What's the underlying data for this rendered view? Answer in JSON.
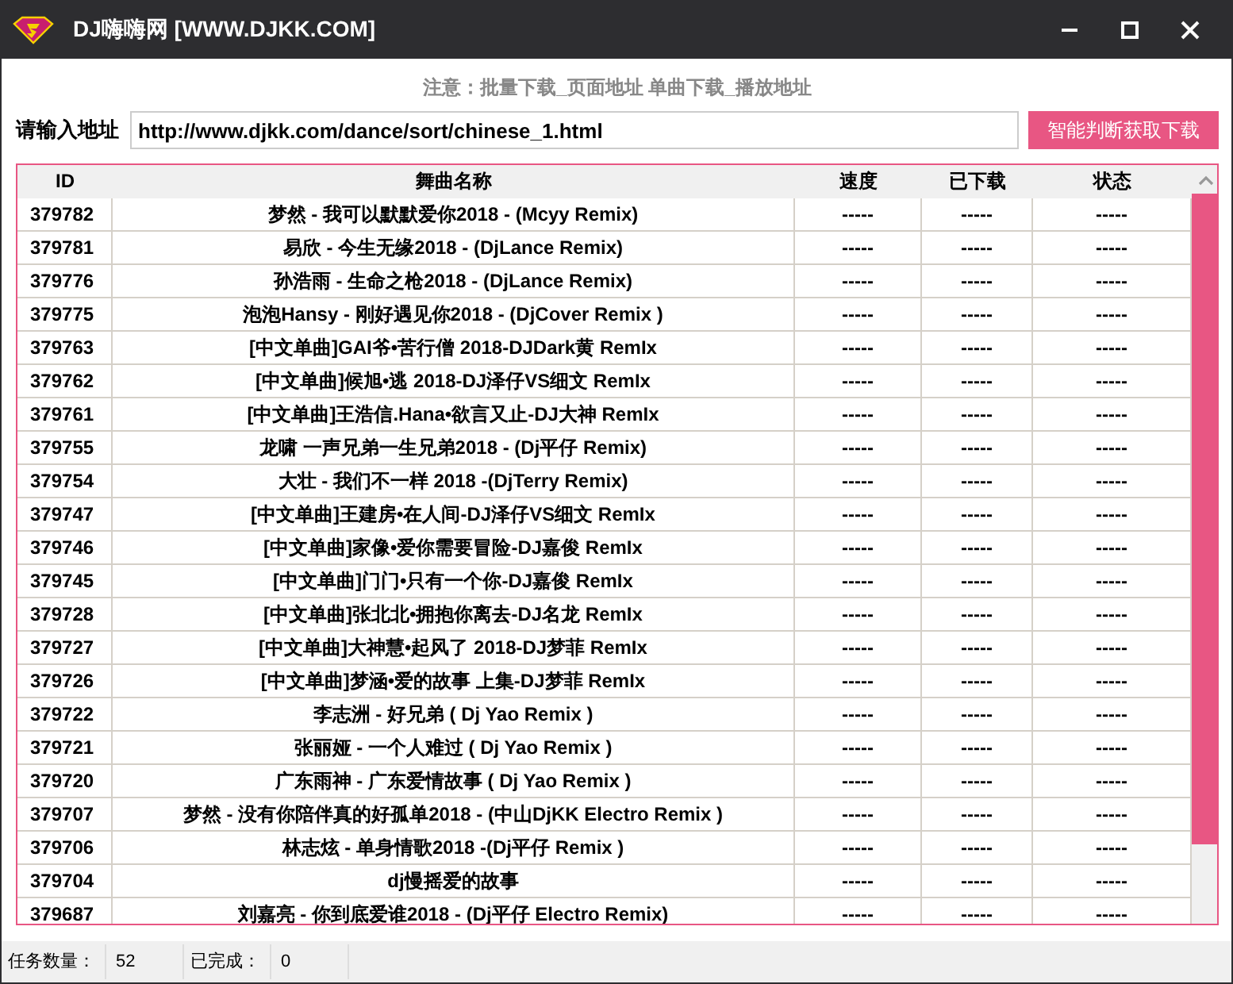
{
  "window": {
    "title": "DJ嗨嗨网 [WWW.DJKK.COM]"
  },
  "notice": "注意：批量下载_页面地址 单曲下载_播放地址",
  "address": {
    "label": "请输入地址",
    "value": "http://www.djkk.com/dance/sort/chinese_1.html"
  },
  "fetch_button": "智能判断获取下载",
  "table": {
    "columns": [
      "ID",
      "舞曲名称",
      "速度",
      "已下载",
      "状态"
    ],
    "rows": [
      [
        "379782",
        "梦然 - 我可以默默爱你2018 - (Mcyy  Remix)",
        "-----",
        "-----",
        "-----"
      ],
      [
        "379781",
        "易欣 - 今生无缘2018 - (DjLance  Remix)",
        "-----",
        "-----",
        "-----"
      ],
      [
        "379776",
        "孙浩雨 - 生命之枪2018 - (DjLance  Remix)",
        "-----",
        "-----",
        "-----"
      ],
      [
        "379775",
        "泡泡Hansy - 刚好遇见你2018 - (DjCover  Remix )",
        "-----",
        "-----",
        "-----"
      ],
      [
        "379763",
        "[中文单曲]GAI爷•苦行僧 2018-DJDark黄 RemIx",
        "-----",
        "-----",
        "-----"
      ],
      [
        "379762",
        "[中文单曲]候旭•逃 2018-DJ泽仔VS细文 RemIx",
        "-----",
        "-----",
        "-----"
      ],
      [
        "379761",
        "[中文单曲]王浩信.Hana•欲言又止-DJ大神 RemIx",
        "-----",
        "-----",
        "-----"
      ],
      [
        "379755",
        "龙啸 一声兄弟一生兄弟2018 - (Dj平仔 Remix)",
        "-----",
        "-----",
        "-----"
      ],
      [
        "379754",
        "大壮 - 我们不一样 2018 -(DjTerry Remix)",
        "-----",
        "-----",
        "-----"
      ],
      [
        "379747",
        "[中文单曲]王建房•在人间-DJ泽仔VS细文 RemIx",
        "-----",
        "-----",
        "-----"
      ],
      [
        "379746",
        "[中文单曲]家像•爱你需要冒险-DJ嘉俊 RemIx",
        "-----",
        "-----",
        "-----"
      ],
      [
        "379745",
        "[中文单曲]门门•只有一个你-DJ嘉俊 RemIx",
        "-----",
        "-----",
        "-----"
      ],
      [
        "379728",
        "[中文单曲]张北北•拥抱你离去-DJ名龙 RemIx",
        "-----",
        "-----",
        "-----"
      ],
      [
        "379727",
        "[中文单曲]大神慧•起风了 2018-DJ梦菲 RemIx",
        "-----",
        "-----",
        "-----"
      ],
      [
        "379726",
        "[中文单曲]梦涵•爱的故事 上集-DJ梦菲 RemIx",
        "-----",
        "-----",
        "-----"
      ],
      [
        "379722",
        "李志洲 - 好兄弟 ( Dj Yao Remix )",
        "-----",
        "-----",
        "-----"
      ],
      [
        "379721",
        "张丽娅 - 一个人难过 ( Dj Yao Remix )",
        "-----",
        "-----",
        "-----"
      ],
      [
        "379720",
        "广东雨神 - 广东爱情故事 ( Dj Yao Remix )",
        "-----",
        "-----",
        "-----"
      ],
      [
        "379707",
        "梦然 - 没有你陪伴真的好孤单2018 - (中山DjKK Electro Remix )",
        "-----",
        "-----",
        "-----"
      ],
      [
        "379706",
        "林志炫 - 单身情歌2018 -(Dj平仔  Remix )",
        "-----",
        "-----",
        "-----"
      ],
      [
        "379704",
        "dj慢摇爱的故事",
        "-----",
        "-----",
        "-----"
      ],
      [
        "379687",
        "刘嘉亮 - 你到底爱谁2018 - (Dj平仔 Electro Remix)",
        "-----",
        "-----",
        "-----"
      ]
    ]
  },
  "status_bar": [
    {
      "label": "任务数量：",
      "value": "52"
    },
    {
      "label": "已完成：",
      "value": "0"
    }
  ]
}
